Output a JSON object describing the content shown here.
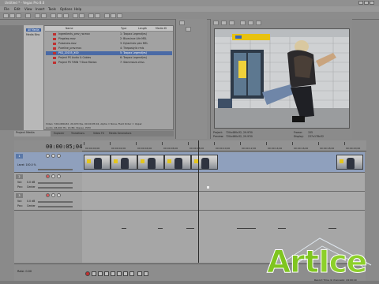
{
  "window": {
    "title": "Untitled * - Vegas Pro 8.0",
    "minimize": "_",
    "maximize": "□",
    "close": "×"
  },
  "menu": [
    "File",
    "Edit",
    "View",
    "Insert",
    "Tools",
    "Options",
    "Help"
  ],
  "project_media": {
    "tree": [
      "All Media",
      "Media Bins"
    ],
    "columns": [
      "Name",
      "Type",
      "Length",
      "Media ID"
    ],
    "rows": [
      {
        "name": "Ingredients_prev_rw.mov",
        "detail": "1: Taxpax Legend(es)"
      },
      {
        "name": "Pingstep.mov",
        "detail": "2: Bluesince Life MEL"
      },
      {
        "name": "Pulsenew.mov",
        "detail": "3: Dylanlistic pbn MEL"
      },
      {
        "name": "Pureline_prev.mov",
        "detail": "4: Thepostylic rmls"
      },
      {
        "name": "PSS_20155_X00",
        "detail": "5: Taxpax Legend(es)"
      },
      {
        "name": "Project PS Audio & Cables",
        "detail": "6: Taxpax Legend(es)"
      },
      {
        "name": "Project PS TWIN T Slow Motion",
        "detail": "7: Stammsize.chiss"
      }
    ],
    "selected_index": 4,
    "info_line1": "Video: 720x480x32, 29.970 fps, 00:00:05:04, Alpha = None, Field Order = Upper",
    "info_line2": "Audio: 48,000 Hz, 16 Bit, Stereo, PCM",
    "tabs": [
      "Project Media",
      "Explorer",
      "Transitions",
      "Video FX",
      "Media Generators"
    ]
  },
  "preview": {
    "info": [
      {
        "label": "Project:",
        "value": "720x480x32, 29.970i"
      },
      {
        "label": "Preview:",
        "value": "720x480x32, 29.970i"
      },
      {
        "label": "Frame:",
        "value": "155"
      },
      {
        "label": "Display:",
        "value": "237x178x32"
      }
    ]
  },
  "timeline": {
    "timecode": "00:00:05;04",
    "ruler": [
      "00:00:00;00",
      "00:00:02;00",
      "00:00:04;00",
      "00:00:06;00",
      "00:00:08;00",
      "00:00:10;00",
      "00:00:12;00",
      "00:00:14;00",
      "00:00:16;00",
      "00:00:18;00",
      "00:00:20;00"
    ],
    "tracks": [
      {
        "number": "1",
        "kind": "video",
        "level_label": "Level: 100.0 %"
      },
      {
        "number": "2",
        "kind": "audio",
        "vol_label": "Vol:",
        "vol_value": "0.0 dB",
        "pan_label": "Pan:",
        "pan_value": "Center"
      },
      {
        "number": "3",
        "kind": "audio",
        "vol_label": "Vol:",
        "vol_value": "0.0 dB",
        "pan_label": "Pan:",
        "pan_value": "Center"
      }
    ]
  },
  "transport": {
    "rate": "Rate: 0.00",
    "status": "Record Time (2 channels): 24:00:10"
  },
  "watermark": {
    "part1": "Art",
    "part2": "Ice"
  },
  "colors": {
    "accent": "#4a6aa6",
    "watermark": "#8dd02a",
    "record": "#c03030"
  }
}
